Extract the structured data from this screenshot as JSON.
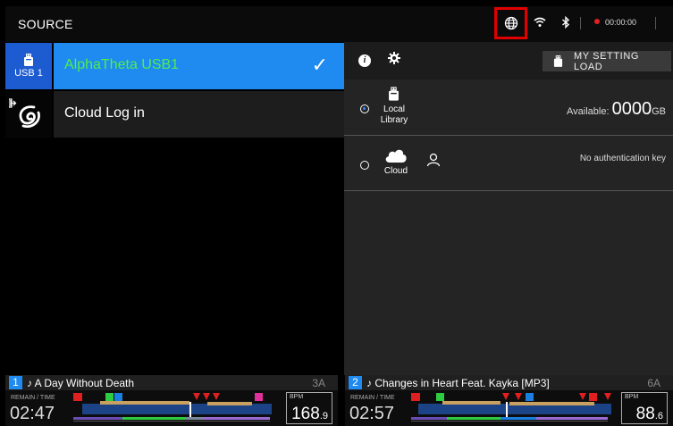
{
  "topbar": {
    "title": "SOURCE",
    "timer": "00:00:00",
    "icons": [
      "globe-icon",
      "wifi-icon",
      "bluetooth-icon",
      "record-icon"
    ],
    "highlight_color": "#e00000"
  },
  "devices": [
    {
      "tab_label": "USB 1",
      "name": "AlphaTheta USB1",
      "selected": true,
      "icon": "usb-icon"
    },
    {
      "tab_label": "",
      "name": "Cloud Log in",
      "selected": false,
      "icon": "cloud-login-icon"
    }
  ],
  "right_panel": {
    "header_button": "MY SETTING LOAD",
    "sources": [
      {
        "label_line1": "Local",
        "label_line2": "Library",
        "selected": true,
        "available_label": "Available:",
        "available_value": "0000",
        "available_unit": "GB"
      },
      {
        "label_line1": "Cloud",
        "label_line2": "",
        "selected": false,
        "status": "No authentication key"
      }
    ]
  },
  "decks": [
    {
      "number": "1",
      "title": "♪ A Day Without Death",
      "key": "3A",
      "remain_label": "REMAIN / TIME",
      "time": "02:47",
      "bpm_label": "BPM",
      "bpm_int": "168",
      "bpm_dec": ".9"
    },
    {
      "number": "2",
      "title": "♪ Changes in Heart Feat. Kayka [MP3]",
      "key": "6A",
      "remain_label": "REMAIN / TIME",
      "time": "02:57",
      "bpm_label": "BPM",
      "bpm_int": "88",
      "bpm_dec": ".6"
    }
  ],
  "colors": {
    "selected_row": "#1f8af0",
    "selected_tab": "#1d5bd1",
    "selected_text": "#4cf04c",
    "record": "#e32020"
  }
}
